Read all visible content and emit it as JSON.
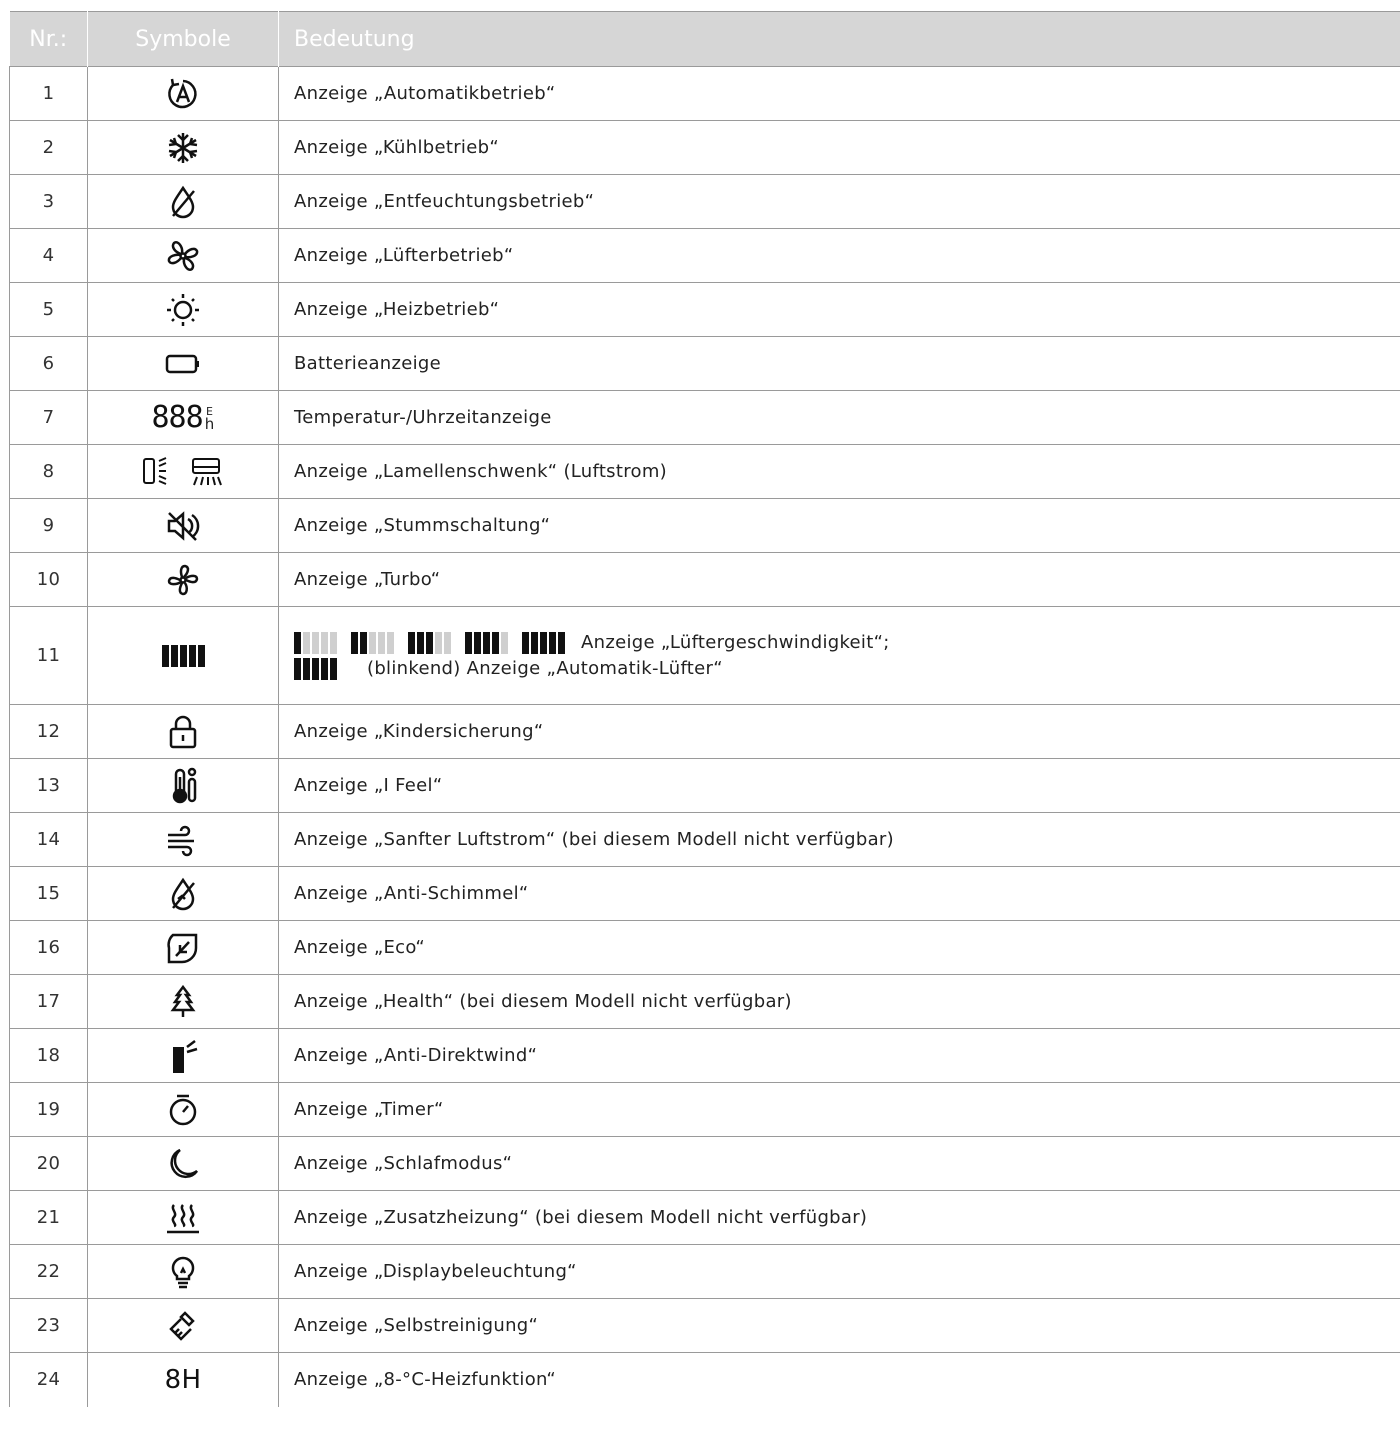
{
  "header": {
    "col_num": "Nr.:",
    "col_symbol": "Symbole",
    "col_meaning": "Bedeutung"
  },
  "rows": [
    {
      "num": "1",
      "icon": "auto-mode-icon",
      "text": "Anzeige „Automatikbetrieb“"
    },
    {
      "num": "2",
      "icon": "snowflake-icon",
      "text": "Anzeige „Kühlbetrieb“"
    },
    {
      "num": "3",
      "icon": "dehumidify-drop-icon",
      "text": "Anzeige „Entfeuchtungsbetrieb“"
    },
    {
      "num": "4",
      "icon": "fan-icon",
      "text": "Anzeige „Lüfterbetrieb“"
    },
    {
      "num": "5",
      "icon": "sun-icon",
      "text": "Anzeige „Heizbetrieb“"
    },
    {
      "num": "6",
      "icon": "battery-icon",
      "text": "Batterieanzeige"
    },
    {
      "num": "7",
      "icon": "seven-segment-display-icon",
      "text": "Temperatur-/Uhrzeitanzeige",
      "display": "888",
      "unit_top": "E",
      "unit_bottom": "h"
    },
    {
      "num": "8",
      "icon": "louver-swing-icon",
      "text": "Anzeige „Lamellenschwenk“ (Luftstrom)"
    },
    {
      "num": "9",
      "icon": "mute-speaker-icon",
      "text": "Anzeige „Stummschaltung“"
    },
    {
      "num": "10",
      "icon": "turbo-fan-icon",
      "text": "Anzeige „Turbo“"
    },
    {
      "num": "11",
      "icon": "fan-speed-bars-icon",
      "text": "Anzeige „Lüftergeschwindigkeit“;",
      "text2": "(blinkend) Anzeige „Automatik-Lüfter“",
      "levels": [
        1,
        2,
        3,
        4,
        5
      ],
      "level_max": 5
    },
    {
      "num": "12",
      "icon": "padlock-icon",
      "text": "Anzeige „Kindersicherung“"
    },
    {
      "num": "13",
      "icon": "thermometer-person-icon",
      "text": "Anzeige „I Feel“"
    },
    {
      "num": "14",
      "icon": "gentle-wind-icon",
      "text": "Anzeige „Sanfter Luftstrom“ (bei diesem Modell nicht verfügbar)"
    },
    {
      "num": "15",
      "icon": "anti-mold-icon",
      "text": "Anzeige „Anti-Schimmel“"
    },
    {
      "num": "16",
      "icon": "eco-leaf-icon",
      "text": "Anzeige „Eco“"
    },
    {
      "num": "17",
      "icon": "tree-icon",
      "text": "Anzeige „Health“ (bei diesem Modell nicht verfügbar)"
    },
    {
      "num": "18",
      "icon": "anti-direct-wind-icon",
      "text": "Anzeige „Anti-Direktwind“"
    },
    {
      "num": "19",
      "icon": "stopwatch-icon",
      "text": "Anzeige „Timer“"
    },
    {
      "num": "20",
      "icon": "moon-icon",
      "text": "Anzeige „Schlafmodus“"
    },
    {
      "num": "21",
      "icon": "heater-waves-icon",
      "text": "Anzeige „Zusatzheizung“ (bei diesem Modell nicht verfügbar)"
    },
    {
      "num": "22",
      "icon": "light-bulb-icon",
      "text": "Anzeige „Displaybeleuchtung“"
    },
    {
      "num": "23",
      "icon": "cleaning-brush-icon",
      "text": "Anzeige „Selbstreinigung“"
    },
    {
      "num": "24",
      "icon": "8h-text-icon",
      "text": "Anzeige „8-°C-Heizfunktion“",
      "symbol_text": "8H"
    }
  ]
}
